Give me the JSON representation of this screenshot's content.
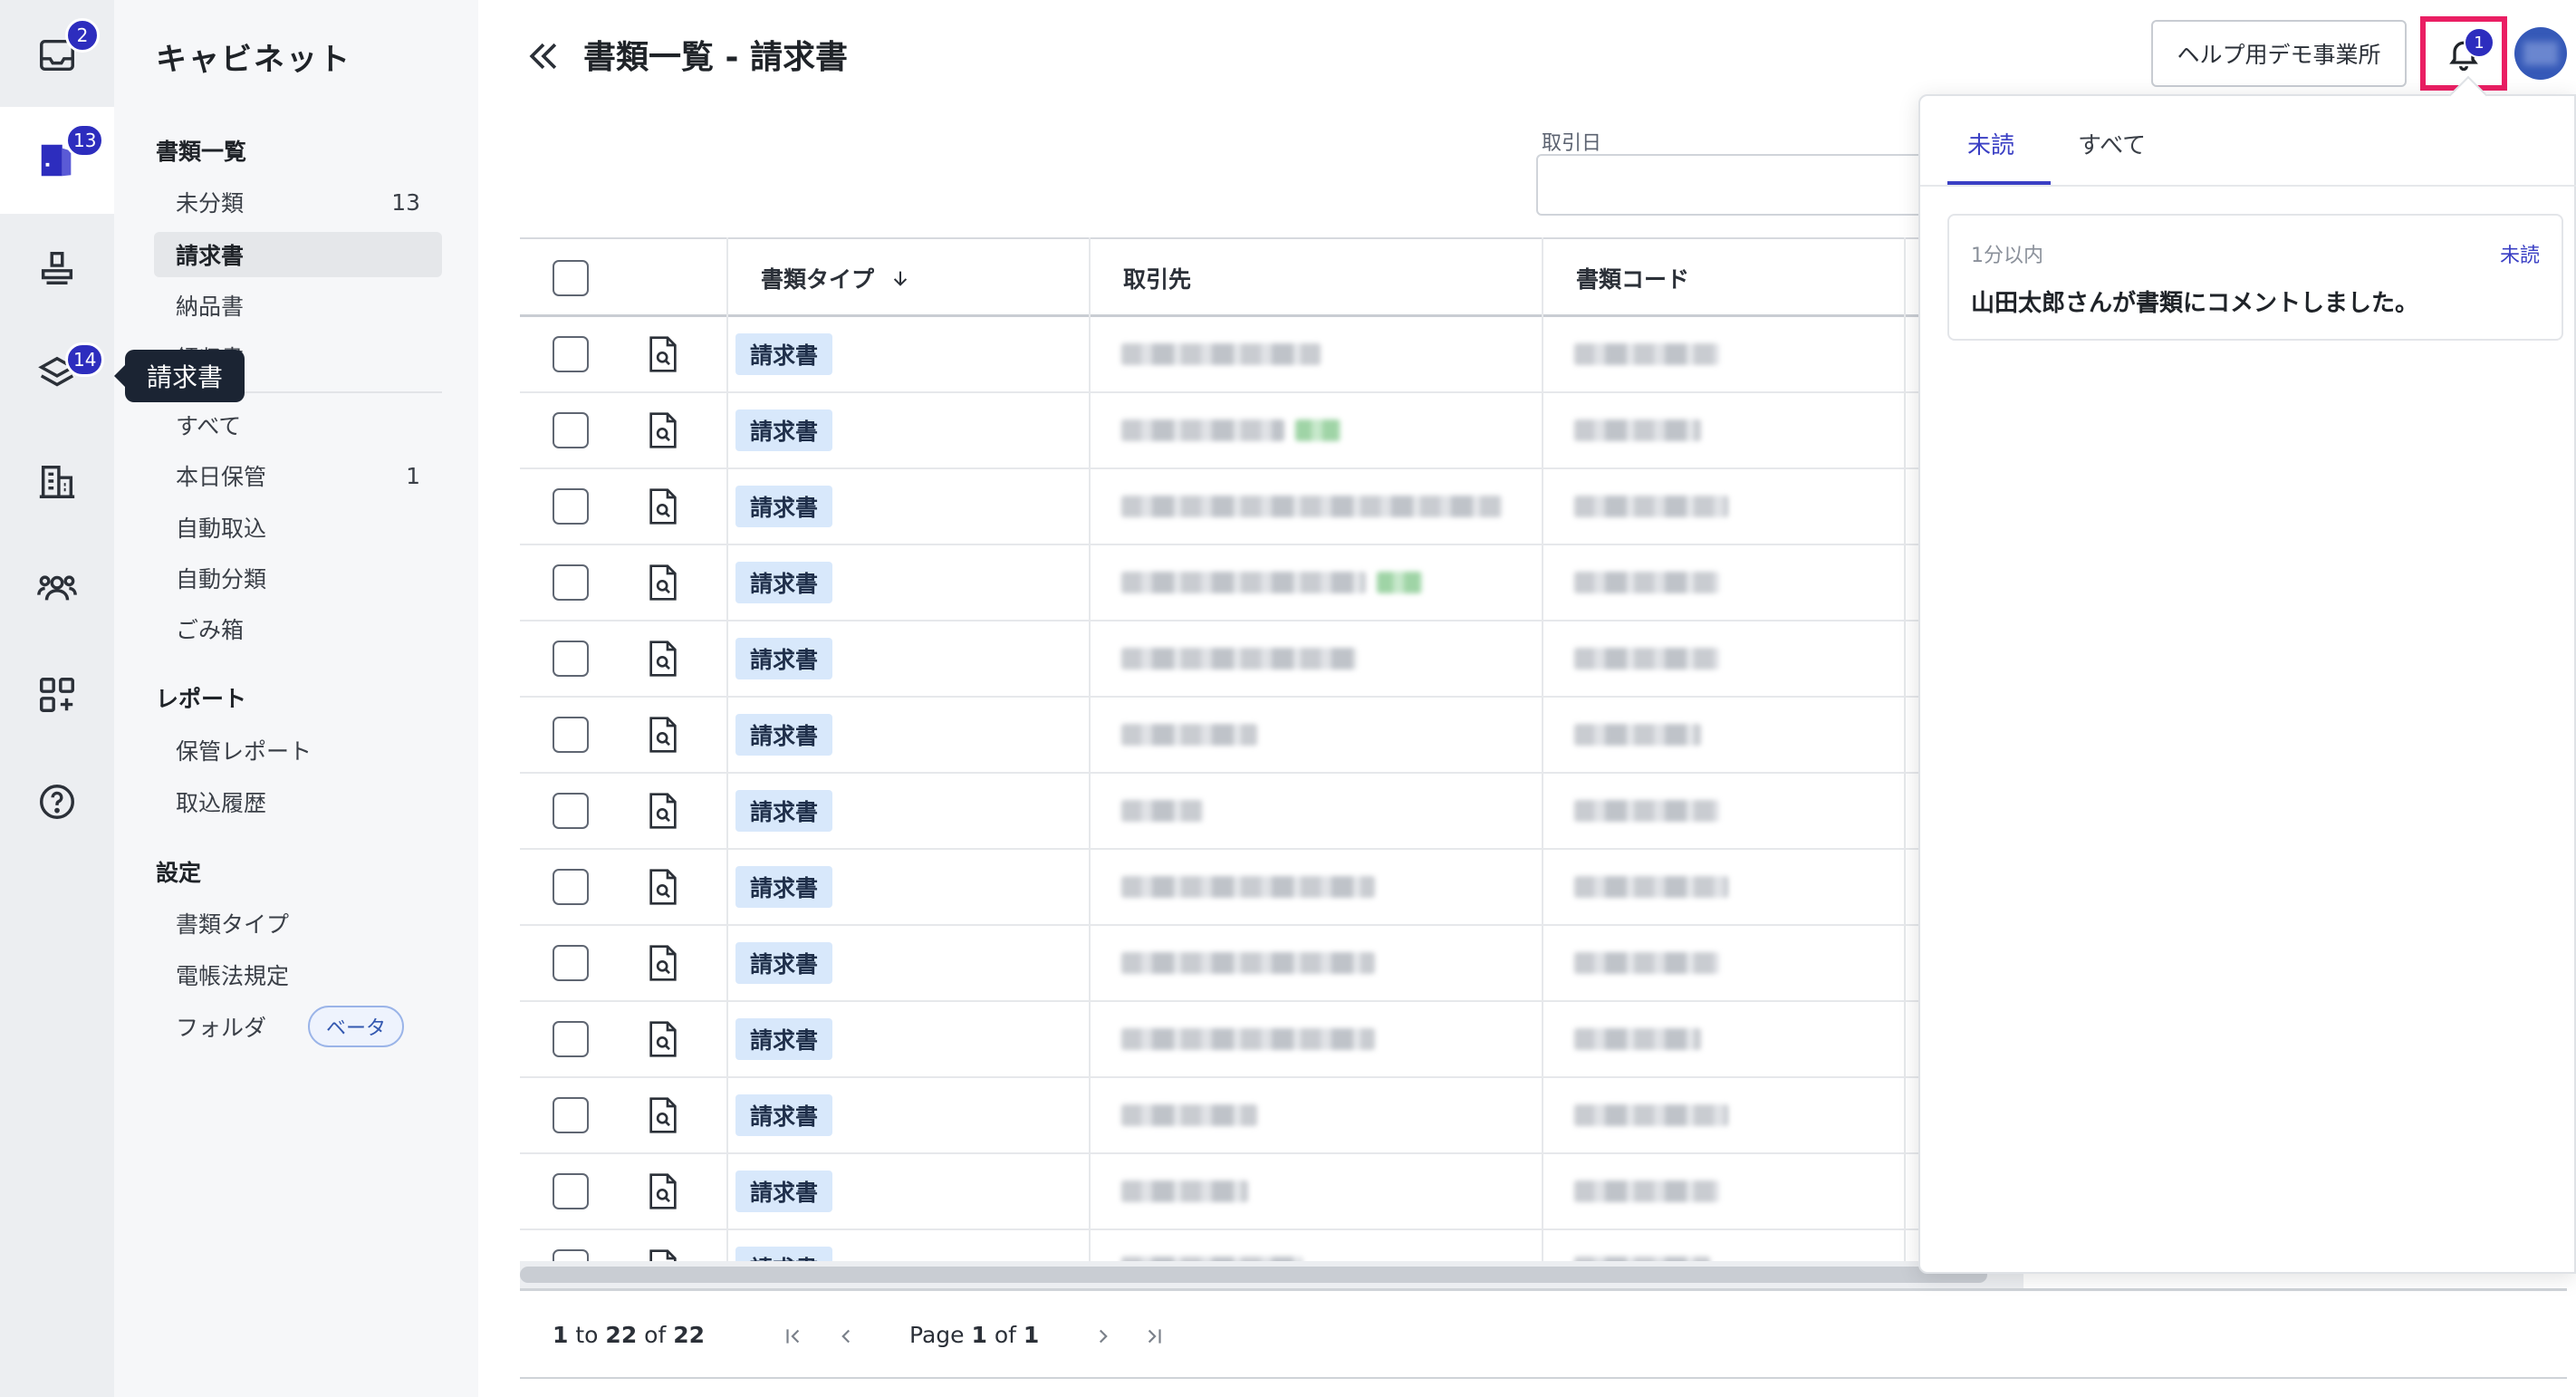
{
  "rail": {
    "badges": {
      "inbox": "2",
      "documents": "13",
      "stack": "14"
    },
    "tooltip": "請求書"
  },
  "sidebar": {
    "title": "キャビネット",
    "sections": {
      "documents": "書類一覧",
      "reports": "レポート",
      "settings": "設定"
    },
    "doc_items": [
      {
        "label": "未分類",
        "count": "13"
      },
      {
        "label": "請求書",
        "count": ""
      },
      {
        "label": "納品書",
        "count": ""
      },
      {
        "label": "領収書",
        "count": ""
      }
    ],
    "misc_items": [
      {
        "label": "すべて",
        "count": ""
      },
      {
        "label": "本日保管",
        "count": "1"
      },
      {
        "label": "自動取込",
        "count": ""
      },
      {
        "label": "自動分類",
        "count": ""
      },
      {
        "label": "ごみ箱",
        "count": ""
      }
    ],
    "report_items": [
      {
        "label": "保管レポート"
      },
      {
        "label": "取込履歴"
      }
    ],
    "settings_items": [
      {
        "label": "書類タイプ"
      },
      {
        "label": "電帳法規定"
      },
      {
        "label": "フォルダ",
        "badge": "ベータ"
      }
    ]
  },
  "header": {
    "title": "書類一覧 - 請求書",
    "office_button": "ヘルプ用デモ事業所",
    "notification_count": "1"
  },
  "filters": {
    "date_label": "取引日"
  },
  "table": {
    "columns": [
      "書類タイプ",
      "取引先",
      "書類コード"
    ],
    "rows": [
      {
        "type": "請求書"
      },
      {
        "type": "請求書"
      },
      {
        "type": "請求書"
      },
      {
        "type": "請求書"
      },
      {
        "type": "請求書"
      },
      {
        "type": "請求書"
      },
      {
        "type": "請求書"
      },
      {
        "type": "請求書"
      },
      {
        "type": "請求書"
      },
      {
        "type": "請求書"
      },
      {
        "type": "請求書"
      },
      {
        "type": "請求書"
      },
      {
        "type": "請求書"
      }
    ]
  },
  "pager": {
    "range_from": "1",
    "range_to_word": "to",
    "range_to": "22",
    "of_word": "of",
    "total": "22",
    "page_word": "Page",
    "page": "1",
    "page_of_word": "of",
    "page_total": "1"
  },
  "notifications": {
    "tabs": [
      "未読",
      "すべて"
    ],
    "items": [
      {
        "time": "1分以内",
        "status": "未読",
        "message": "山田太郎さんが書類にコメントしました。"
      }
    ]
  },
  "colors": {
    "accent": "#2d2dbe",
    "highlight": "#ea1e63",
    "tag_bg": "#d8e8fb"
  }
}
